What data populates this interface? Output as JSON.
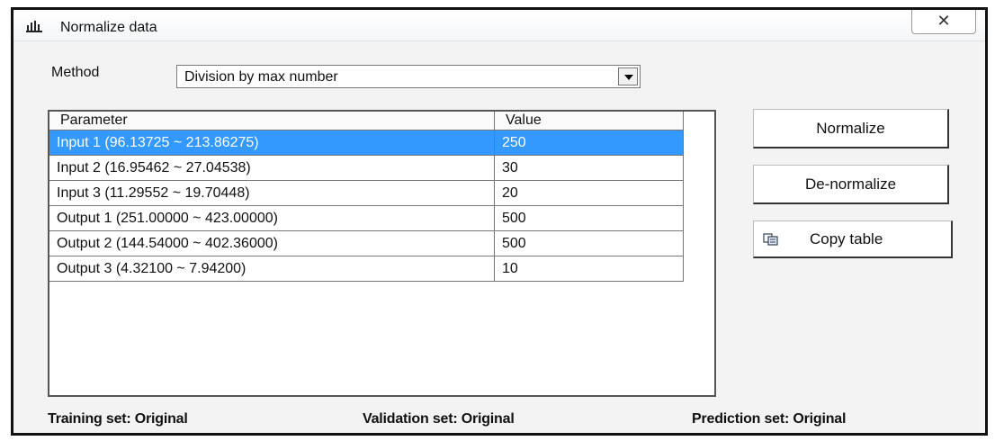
{
  "window": {
    "title": "Normalize data",
    "close_label": "ⅹ"
  },
  "method": {
    "label": "Method",
    "selected": "Division by max number"
  },
  "table": {
    "columns": [
      "Parameter",
      "Value"
    ],
    "rows": [
      {
        "parameter": "Input 1  (96.13725 ~ 213.86275)",
        "value": "250",
        "selected": true
      },
      {
        "parameter": "Input 2  (16.95462 ~ 27.04538)",
        "value": "30"
      },
      {
        "parameter": "Input 3  (11.29552 ~ 19.70448)",
        "value": "20"
      },
      {
        "parameter": "Output 1  (251.00000 ~ 423.00000)",
        "value": "500"
      },
      {
        "parameter": "Output 2  (144.54000 ~ 402.36000)",
        "value": "500"
      },
      {
        "parameter": "Output 3  (4.32100 ~ 7.94200)",
        "value": "10"
      }
    ]
  },
  "buttons": {
    "normalize": "Normalize",
    "denormalize": "De-normalize",
    "copy_table": "Copy table"
  },
  "footer": {
    "training": "Training set: Original",
    "validation": "Validation set: Original",
    "prediction": "Prediction set: Original"
  },
  "colors": {
    "selection": "#3399ff",
    "window_bg": "#f3f3f3"
  }
}
